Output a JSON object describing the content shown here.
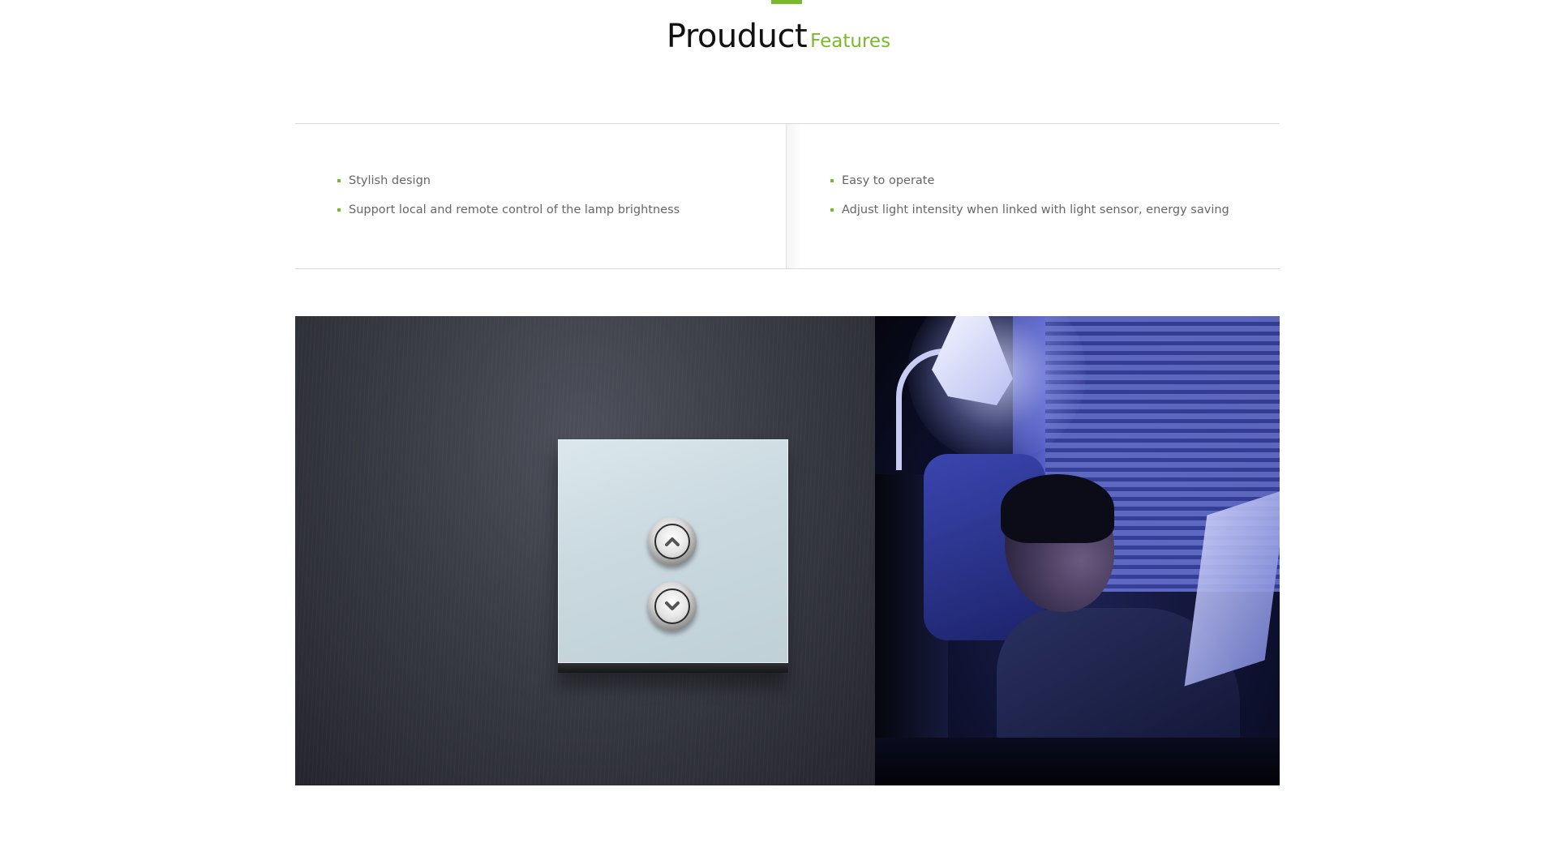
{
  "heading": {
    "main": "Prouduct",
    "sub": "Features"
  },
  "features": {
    "left": [
      "Stylish design",
      "Support local and remote control of the lamp brightness"
    ],
    "right": [
      "Easy to operate",
      "Adjust light intensity when linked with light sensor, energy saving"
    ]
  },
  "colors": {
    "accent": "#7ab929",
    "text": "#666666",
    "divider": "#d9d9d9"
  },
  "icons": {
    "up": "chevron-up-icon",
    "down": "chevron-down-icon"
  }
}
